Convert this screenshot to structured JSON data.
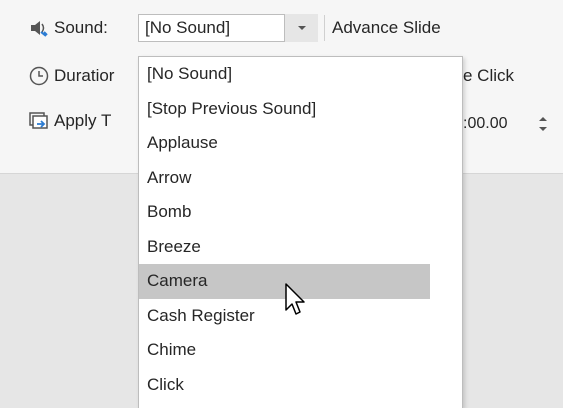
{
  "sound": {
    "label": "Sound:",
    "selected": "[No Sound]"
  },
  "advance_slide_label": "Advance Slide",
  "duration_label": "Duratior",
  "apply_label": "Apply T",
  "on_click_label": "e Click",
  "after_value": ":00.00",
  "dropdown": {
    "items": [
      "[No Sound]",
      "[Stop Previous Sound]",
      "Applause",
      "Arrow",
      "Bomb",
      "Breeze",
      "Camera",
      "Cash Register",
      "Chime",
      "Click"
    ],
    "hovered": "Camera"
  },
  "icons": [
    "speaker-icon",
    "clock-icon",
    "apply-to-all-icon",
    "chevron-down-icon",
    "spin-arrows-icon",
    "mouse-pointer-icon"
  ]
}
